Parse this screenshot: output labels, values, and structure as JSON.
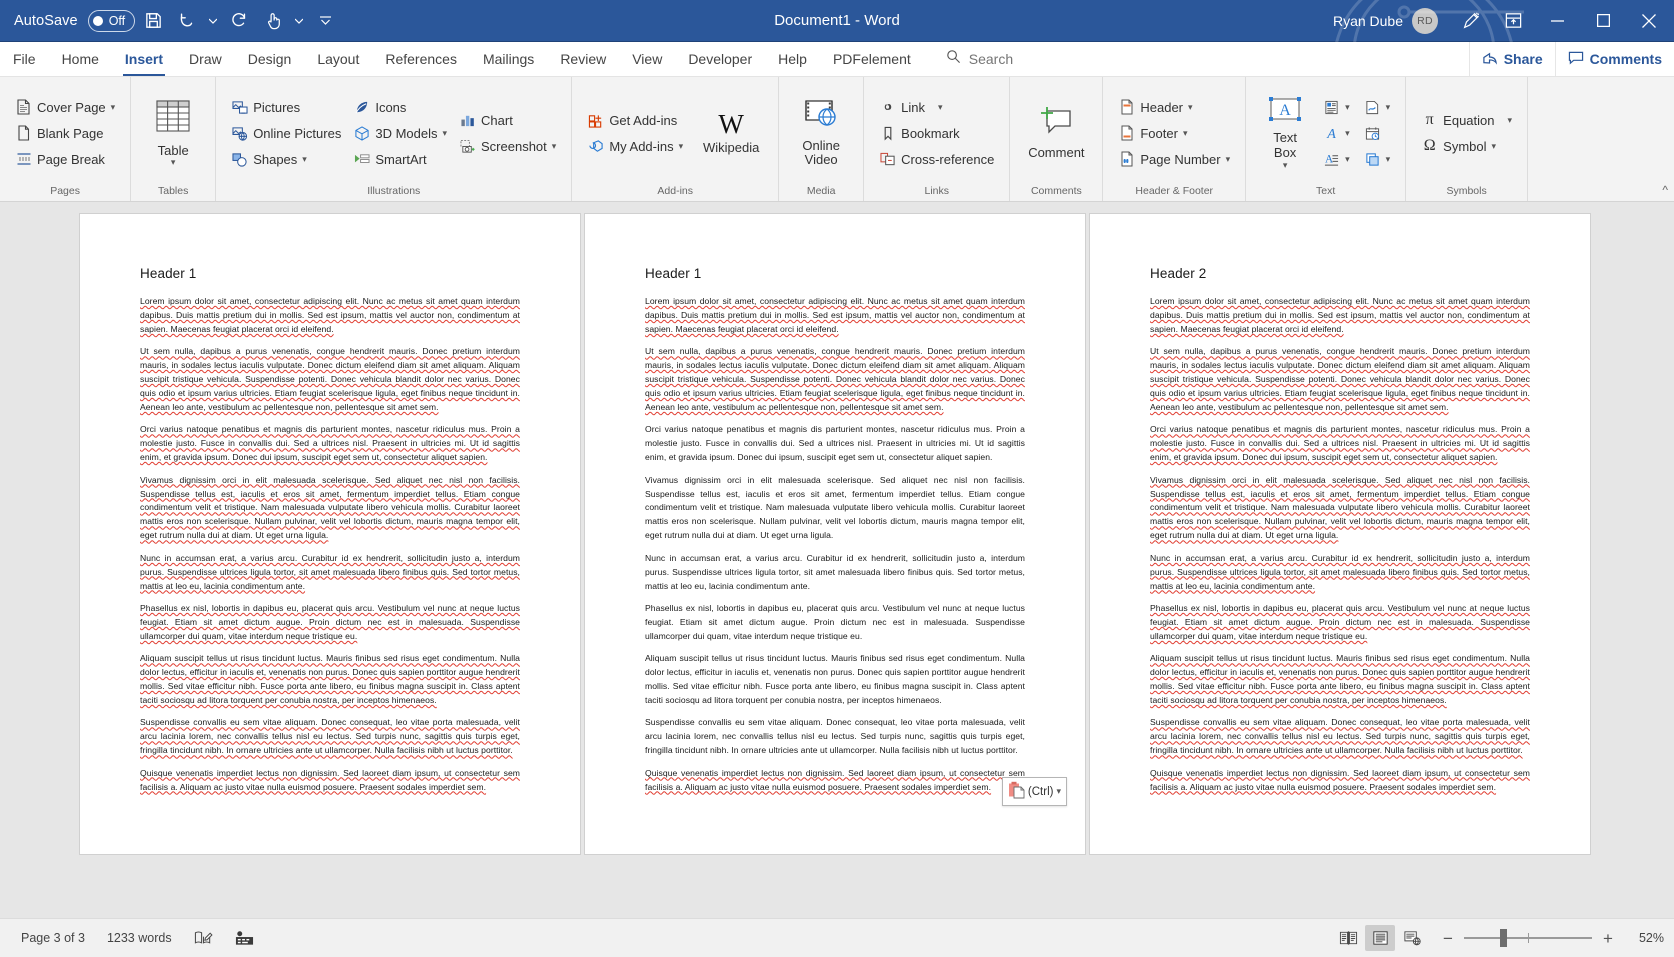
{
  "titlebar": {
    "autosave_label": "AutoSave",
    "autosave_state": "Off",
    "save_icon": "save-icon",
    "undo_icon": "undo-icon",
    "redo_icon": "redo-icon",
    "touch_icon": "touch-mode-icon",
    "customize_icon": "customize-quick-access-toolbar-icon",
    "document_title": "Document1  -  Word",
    "user_name": "Ryan Dube",
    "user_initials": "RD",
    "ink_icon": "ink-pen-icon",
    "ribbon_display_icon": "ribbon-display-options-icon",
    "minimize_icon": "minimize-icon",
    "maximize_icon": "maximize-icon",
    "close_icon": "close-icon"
  },
  "tabs": [
    {
      "label": "File",
      "active": false
    },
    {
      "label": "Home",
      "active": false
    },
    {
      "label": "Insert",
      "active": true
    },
    {
      "label": "Draw",
      "active": false
    },
    {
      "label": "Design",
      "active": false
    },
    {
      "label": "Layout",
      "active": false
    },
    {
      "label": "References",
      "active": false
    },
    {
      "label": "Mailings",
      "active": false
    },
    {
      "label": "Review",
      "active": false
    },
    {
      "label": "View",
      "active": false
    },
    {
      "label": "Developer",
      "active": false
    },
    {
      "label": "Help",
      "active": false
    },
    {
      "label": "PDFelement",
      "active": false
    }
  ],
  "search": {
    "placeholder": "Search",
    "icon": "search-icon"
  },
  "actions": {
    "share_label": "Share",
    "share_icon": "share-icon",
    "comments_label": "Comments",
    "comments_icon": "comment-bubble-icon"
  },
  "ribbon": {
    "collapse_icon": "collapse-ribbon-caret",
    "groups": [
      {
        "name": "Pages",
        "label": "Pages",
        "items": [
          {
            "label": "Cover Page",
            "icon": "cover-page-icon",
            "caret": true
          },
          {
            "label": "Blank Page",
            "icon": "blank-page-icon",
            "caret": false
          },
          {
            "label": "Page Break",
            "icon": "page-break-icon",
            "caret": false
          }
        ]
      },
      {
        "name": "Tables",
        "label": "Tables",
        "big": [
          {
            "label": "Table",
            "icon": "table-icon",
            "caret": true
          }
        ]
      },
      {
        "name": "Illustrations",
        "label": "Illustrations",
        "items": [
          {
            "label": "Pictures",
            "icon": "pictures-icon",
            "caret": false
          },
          {
            "label": "Online Pictures",
            "icon": "online-pictures-icon",
            "caret": false
          },
          {
            "label": "Shapes",
            "icon": "shapes-icon",
            "caret": true
          },
          {
            "label": "Icons",
            "icon": "icons-icon",
            "caret": false
          },
          {
            "label": "3D Models",
            "icon": "3d-models-icon",
            "caret": true
          },
          {
            "label": "SmartArt",
            "icon": "smartart-icon",
            "caret": false
          },
          {
            "label": "Chart",
            "icon": "chart-icon",
            "caret": false
          },
          {
            "label": "Screenshot",
            "icon": "screenshot-icon",
            "caret": true
          }
        ]
      },
      {
        "name": "Add-ins",
        "label": "Add-ins",
        "items": [
          {
            "label": "Get Add-ins",
            "icon": "get-add-ins-icon",
            "caret": false
          },
          {
            "label": "My Add-ins",
            "icon": "my-add-ins-icon",
            "caret": true
          }
        ],
        "big": [
          {
            "label": "Wikipedia",
            "icon": "wikipedia-icon",
            "caret": false
          }
        ]
      },
      {
        "name": "Media",
        "label": "Media",
        "big": [
          {
            "label": "Online Video",
            "icon": "online-video-icon",
            "caret": false
          }
        ]
      },
      {
        "name": "Links",
        "label": "Links",
        "items": [
          {
            "label": "Link",
            "icon": "link-icon",
            "caret": true
          },
          {
            "label": "Bookmark",
            "icon": "bookmark-icon",
            "caret": false
          },
          {
            "label": "Cross-reference",
            "icon": "cross-reference-icon",
            "caret": false
          }
        ]
      },
      {
        "name": "Comments",
        "label": "Comments",
        "big": [
          {
            "label": "Comment",
            "icon": "new-comment-icon",
            "caret": false
          }
        ]
      },
      {
        "name": "Header & Footer",
        "label": "Header & Footer",
        "items": [
          {
            "label": "Header",
            "icon": "header-icon",
            "caret": true
          },
          {
            "label": "Footer",
            "icon": "footer-icon",
            "caret": true
          },
          {
            "label": "Page Number",
            "icon": "page-number-icon",
            "caret": true
          }
        ]
      },
      {
        "name": "Text",
        "label": "Text",
        "big": [
          {
            "label": "Text Box",
            "icon": "text-box-icon",
            "caret": true
          }
        ],
        "items": [
          {
            "label": "",
            "icon": "quick-parts-icon",
            "caret": true
          },
          {
            "label": "",
            "icon": "wordart-icon",
            "caret": true
          },
          {
            "label": "",
            "icon": "drop-cap-icon",
            "caret": true
          },
          {
            "label": "",
            "icon": "signature-line-icon",
            "caret": true
          },
          {
            "label": "",
            "icon": "date-and-time-icon",
            "caret": false
          },
          {
            "label": "",
            "icon": "object-icon",
            "caret": true
          }
        ]
      },
      {
        "name": "Symbols",
        "label": "Symbols",
        "items": [
          {
            "label": "Equation",
            "icon": "equation-icon",
            "caret": true
          },
          {
            "label": "Symbol",
            "icon": "symbol-icon",
            "caret": true
          }
        ]
      }
    ]
  },
  "document": {
    "pages": [
      {
        "heading": "Header 1",
        "paragraphs": [
          "Lorem ipsum dolor sit amet, consectetur adipiscing elit. Nunc ac metus sit amet quam interdum dapibus. Duis mattis pretium dui in mollis. Sed est ipsum, mattis vel auctor non, condimentum at sapien. Maecenas feugiat placerat orci id eleifend.",
          "Ut sem nulla, dapibus a purus venenatis, congue hendrerit mauris. Donec pretium interdum mauris, in sodales lectus iaculis vulputate. Donec dictum eleifend diam sit amet aliquam. Aliquam suscipit tristique vehicula. Suspendisse potenti. Donec vehicula blandit dolor nec varius. Donec quis odio et ipsum varius ultricies. Etiam feugiat scelerisque ligula, eget finibus neque tincidunt in. Aenean leo ante, vestibulum ac pellentesque non, pellentesque sit amet sem.",
          "Orci varius natoque penatibus et magnis dis parturient montes, nascetur ridiculus mus. Proin a molestie justo. Fusce in convallis dui. Sed a ultrices nisl. Praesent in ultricies mi. Ut id sagittis enim, et gravida ipsum. Donec dui ipsum, suscipit eget sem ut, consectetur aliquet sapien.",
          "Vivamus dignissim orci in elit malesuada scelerisque. Sed aliquet nec nisl non facilisis. Suspendisse tellus est, iaculis et eros sit amet, fermentum imperdiet tellus. Etiam congue condimentum velit et tristique. Nam malesuada vulputate libero vehicula mollis. Curabitur laoreet mattis eros non scelerisque. Nullam pulvinar, velit vel lobortis dictum, mauris magna tempor elit, eget rutrum nulla dui at diam. Ut eget urna ligula.",
          "Nunc in accumsan erat, a varius arcu. Curabitur id ex hendrerit, sollicitudin justo a, interdum purus. Suspendisse ultrices ligula tortor, sit amet malesuada libero finibus quis. Sed tortor metus, mattis at leo eu, lacinia condimentum ante.",
          "Phasellus ex nisl, lobortis in dapibus eu, placerat quis arcu. Vestibulum vel nunc at neque luctus feugiat. Etiam sit amet dictum augue. Proin dictum nec est in malesuada. Suspendisse ullamcorper dui quam, vitae interdum neque tristique eu.",
          "Aliquam suscipit tellus ut risus tincidunt luctus. Mauris finibus sed risus eget condimentum. Nulla dolor lectus, efficitur in iaculis et, venenatis non purus. Donec quis sapien porttitor augue hendrerit mollis. Sed vitae efficitur nibh. Fusce porta ante libero, eu finibus magna suscipit in. Class aptent taciti sociosqu ad litora torquent per conubia nostra, per inceptos himenaeos.",
          "Suspendisse convallis eu sem vitae aliquam. Donec consequat, leo vitae porta malesuada, velit arcu lacinia lorem, nec convallis tellus nisl eu lectus. Sed turpis nunc, sagittis quis turpis eget, fringilla tincidunt nibh. In ornare ultricies ante ut ullamcorper. Nulla facilisis nibh ut luctus porttitor.",
          " Quisque venenatis imperdiet lectus non dignissim. Sed laoreet diam ipsum, ut consectetur sem facilisis a. Aliquam ac justo vitae nulla euismod posuere. Praesent sodales imperdiet sem."
        ]
      },
      {
        "heading": "Header 1",
        "paragraphs": [
          "Lorem ipsum dolor sit amet, consectetur adipiscing elit. Nunc ac metus sit amet quam interdum dapibus. Duis mattis pretium dui in mollis. Sed est ipsum, mattis vel auctor non, condimentum at sapien. Maecenas feugiat placerat orci id eleifend.",
          "Ut sem nulla, dapibus a purus venenatis, congue hendrerit mauris. Donec pretium interdum mauris, in sodales lectus iaculis vulputate. Donec dictum eleifend diam sit amet aliquam. Aliquam suscipit tristique vehicula. Suspendisse potenti. Donec vehicula blandit dolor nec varius. Donec quis odio et ipsum varius ultricies. Etiam feugiat scelerisque ligula, eget finibus neque tincidunt in. Aenean leo ante, vestibulum ac pellentesque non, pellentesque sit amet sem.",
          "Orci varius natoque penatibus et magnis dis parturient montes, nascetur ridiculus mus. Proin a molestie justo. Fusce in convallis dui. Sed a ultrices nisl. Praesent in ultricies mi. Ut id sagittis enim, et gravida ipsum. Donec dui ipsum, suscipit eget sem ut, consectetur aliquet sapien.",
          "Vivamus dignissim orci in elit malesuada scelerisque. Sed aliquet nec nisl non facilisis. Suspendisse tellus est, iaculis et eros sit amet, fermentum imperdiet tellus. Etiam congue condimentum velit et tristique. Nam malesuada vulputate libero vehicula mollis. Curabitur laoreet mattis eros non scelerisque. Nullam pulvinar, velit vel lobortis dictum, mauris magna tempor elit, eget rutrum nulla dui at diam. Ut eget urna ligula.",
          "Nunc in accumsan erat, a varius arcu. Curabitur id ex hendrerit, sollicitudin justo a, interdum purus. Suspendisse ultrices ligula tortor, sit amet malesuada libero finibus quis. Sed tortor metus, mattis at leo eu, lacinia condimentum ante.",
          "Phasellus ex nisl, lobortis in dapibus eu, placerat quis arcu. Vestibulum vel nunc at neque luctus feugiat. Etiam sit amet dictum augue. Proin dictum nec est in malesuada. Suspendisse ullamcorper dui quam, vitae interdum neque tristique eu.",
          "Aliquam suscipit tellus ut risus tincidunt luctus. Mauris finibus sed risus eget condimentum. Nulla dolor lectus, efficitur in iaculis et, venenatis non purus. Donec quis sapien porttitor augue hendrerit mollis. Sed vitae efficitur nibh. Fusce porta ante libero, eu finibus magna suscipit in. Class aptent taciti sociosqu ad litora torquent per conubia nostra, per inceptos himenaeos.",
          "Suspendisse convallis eu sem vitae aliquam. Donec consequat, leo vitae porta malesuada, velit arcu lacinia lorem, nec convallis tellus nisl eu lectus. Sed turpis nunc, sagittis quis turpis eget, fringilla tincidunt nibh. In ornare ultricies ante ut ullamcorper. Nulla facilisis nibh ut luctus porttitor.",
          " Quisque venenatis imperdiet lectus non dignissim. Sed laoreet diam ipsum, ut consectetur sem facilisis a. Aliquam ac justo vitae nulla euismod posuere. Praesent sodales imperdiet sem."
        ]
      },
      {
        "heading": "Header 2",
        "paragraphs": [
          "Lorem ipsum dolor sit amet, consectetur adipiscing elit. Nunc ac metus sit amet quam interdum dapibus. Duis mattis pretium dui in mollis. Sed est ipsum, mattis vel auctor non, condimentum at sapien. Maecenas feugiat placerat orci id eleifend.",
          "Ut sem nulla, dapibus a purus venenatis, congue hendrerit mauris. Donec pretium interdum mauris, in sodales lectus iaculis vulputate. Donec dictum eleifend diam sit amet aliquam. Aliquam suscipit tristique vehicula. Suspendisse potenti. Donec vehicula blandit dolor nec varius. Donec quis odio et ipsum varius ultricies. Etiam feugiat scelerisque ligula, eget finibus neque tincidunt in. Aenean leo ante, vestibulum ac pellentesque non, pellentesque sit amet sem.",
          "Orci varius natoque penatibus et magnis dis parturient montes, nascetur ridiculus mus. Proin a molestie justo. Fusce in convallis dui. Sed a ultrices nisl. Praesent in ultricies mi. Ut id sagittis enim, et gravida ipsum. Donec dui ipsum, suscipit eget sem ut, consectetur aliquet sapien.",
          "Vivamus dignissim orci in elit malesuada scelerisque. Sed aliquet nec nisl non facilisis. Suspendisse tellus est, iaculis et eros sit amet, fermentum imperdiet tellus. Etiam congue condimentum velit et tristique. Nam malesuada vulputate libero vehicula mollis. Curabitur laoreet mattis eros non scelerisque. Nullam pulvinar, velit vel lobortis dictum, mauris magna tempor elit, eget rutrum nulla dui at diam. Ut eget urna ligula.",
          "Nunc in accumsan erat, a varius arcu. Curabitur id ex hendrerit, sollicitudin justo a, interdum purus. Suspendisse ultrices ligula tortor, sit amet malesuada libero finibus quis. Sed tortor metus, mattis at leo eu, lacinia condimentum ante.",
          "Phasellus ex nisl, lobortis in dapibus eu, placerat quis arcu. Vestibulum vel nunc at neque luctus feugiat. Etiam sit amet dictum augue. Proin dictum nec est in malesuada. Suspendisse ullamcorper dui quam, vitae interdum neque tristique eu.",
          "Aliquam suscipit tellus ut risus tincidunt luctus. Mauris finibus sed risus eget condimentum. Nulla dolor lectus, efficitur in iaculis et, venenatis non purus. Donec quis sapien porttitor augue hendrerit mollis. Sed vitae efficitur nibh. Fusce porta ante libero, eu finibus magna suscipit in. Class aptent taciti sociosqu ad litora torquent per conubia nostra, per inceptos himenaeos.",
          "Suspendisse convallis eu sem vitae aliquam. Donec consequat, leo vitae porta malesuada, velit arcu lacinia lorem, nec convallis tellus nisl eu lectus. Sed turpis nunc, sagittis quis turpis eget, fringilla tincidunt nibh. In ornare ultricies ante ut ullamcorper. Nulla facilisis nibh ut luctus porttitor.",
          " Quisque venenatis imperdiet lectus non dignissim. Sed laoreet diam ipsum, ut consectetur sem facilisis a. Aliquam ac justo vitae nulla euismod posuere. Praesent sodales imperdiet sem."
        ]
      }
    ],
    "paste_options": {
      "label": "(Ctrl)",
      "icon": "paste-options-clipboard-icon",
      "caret": "▾"
    }
  },
  "statusbar": {
    "page_indicator": "Page 3 of 3",
    "word_count": "1233 words",
    "proofing_icon": "proofing-errors-icon",
    "accessibility_icon": "accessibility-checker-icon",
    "views": [
      {
        "name": "read-mode",
        "icon": "read-mode-icon",
        "active": false
      },
      {
        "name": "print-layout",
        "icon": "print-layout-icon",
        "active": true
      },
      {
        "name": "web-layout",
        "icon": "web-layout-icon",
        "active": false
      }
    ],
    "zoom_out_icon": "zoom-out-icon",
    "zoom_in_icon": "zoom-in-icon",
    "zoom_level": "52%"
  },
  "colors": {
    "brand": "#2b579a",
    "ribbon_bg": "#f3f3f3",
    "doc_bg": "#e6e6e6",
    "spellcheck": "#e03b2f"
  }
}
